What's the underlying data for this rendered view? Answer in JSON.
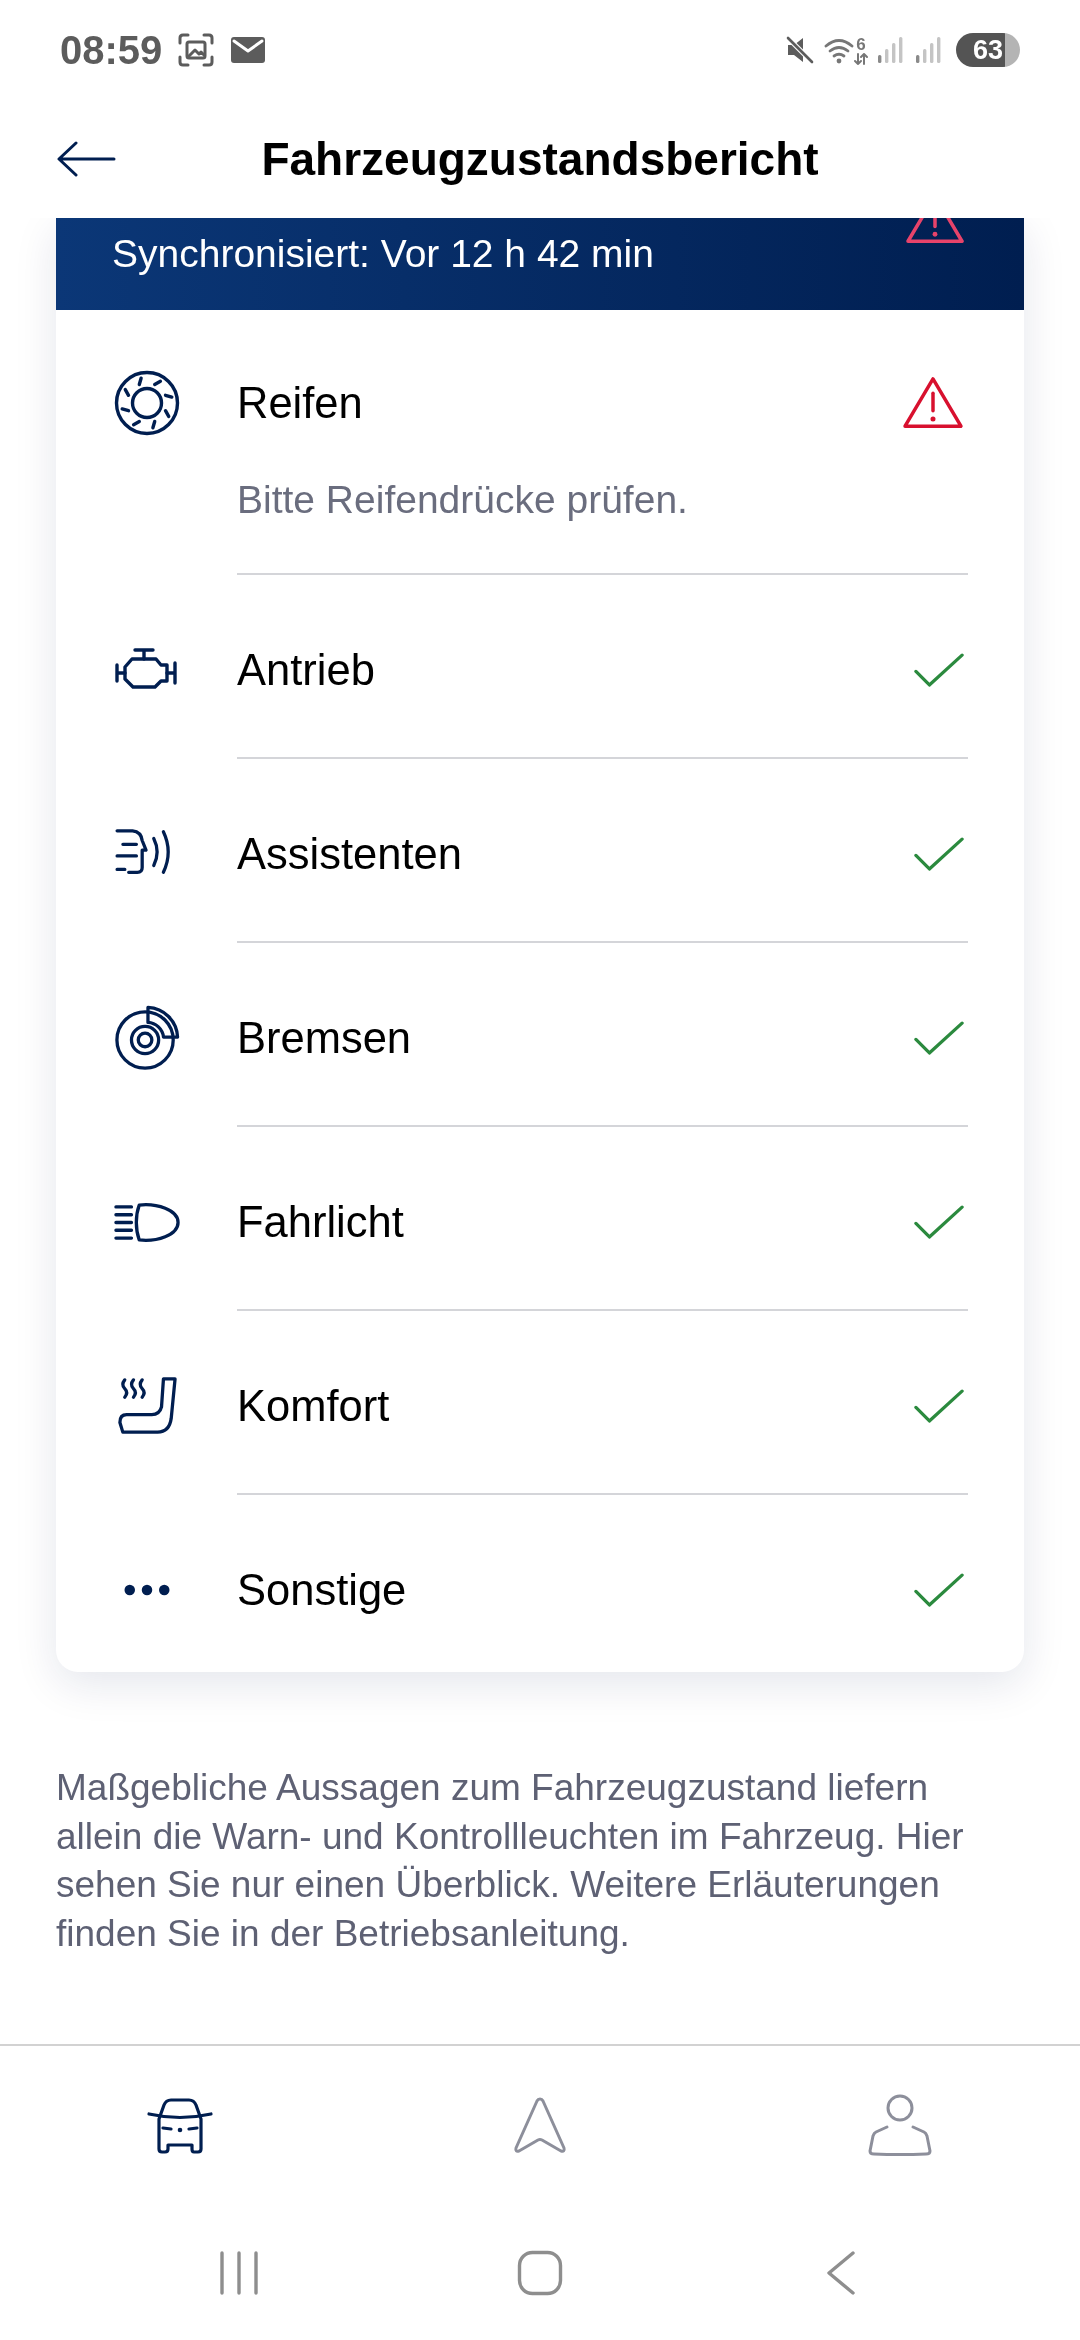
{
  "status_bar": {
    "time": "08:59",
    "wifi_label": "6",
    "battery": "63"
  },
  "header": {
    "title": "Fahrzeugzustandsbericht"
  },
  "sync_banner": {
    "text": "Synchronisiert: Vor 12 h 42 min",
    "warning": true
  },
  "categories": [
    {
      "label": "Reifen",
      "warning": true,
      "message": "Bitte Reifendrücke prüfen."
    },
    {
      "label": "Antrieb",
      "warning": false
    },
    {
      "label": "Assistenten",
      "warning": false
    },
    {
      "label": "Bremsen",
      "warning": false
    },
    {
      "label": "Fahrlicht",
      "warning": false
    },
    {
      "label": "Komfort",
      "warning": false
    },
    {
      "label": "Sonstige",
      "warning": false
    }
  ],
  "disclaimer": "Maßgebliche Aussagen zum Fahrzeugzustand liefern allein die Warn- und Kontrollleuchten im Fahrzeug. Hier sehen Sie nur einen Überblick. Weitere Erläuterungen finden Sie in der Betriebsanleitung.",
  "bottom_nav": [
    {
      "selected": true
    },
    {
      "selected": false
    },
    {
      "selected": false
    }
  ]
}
